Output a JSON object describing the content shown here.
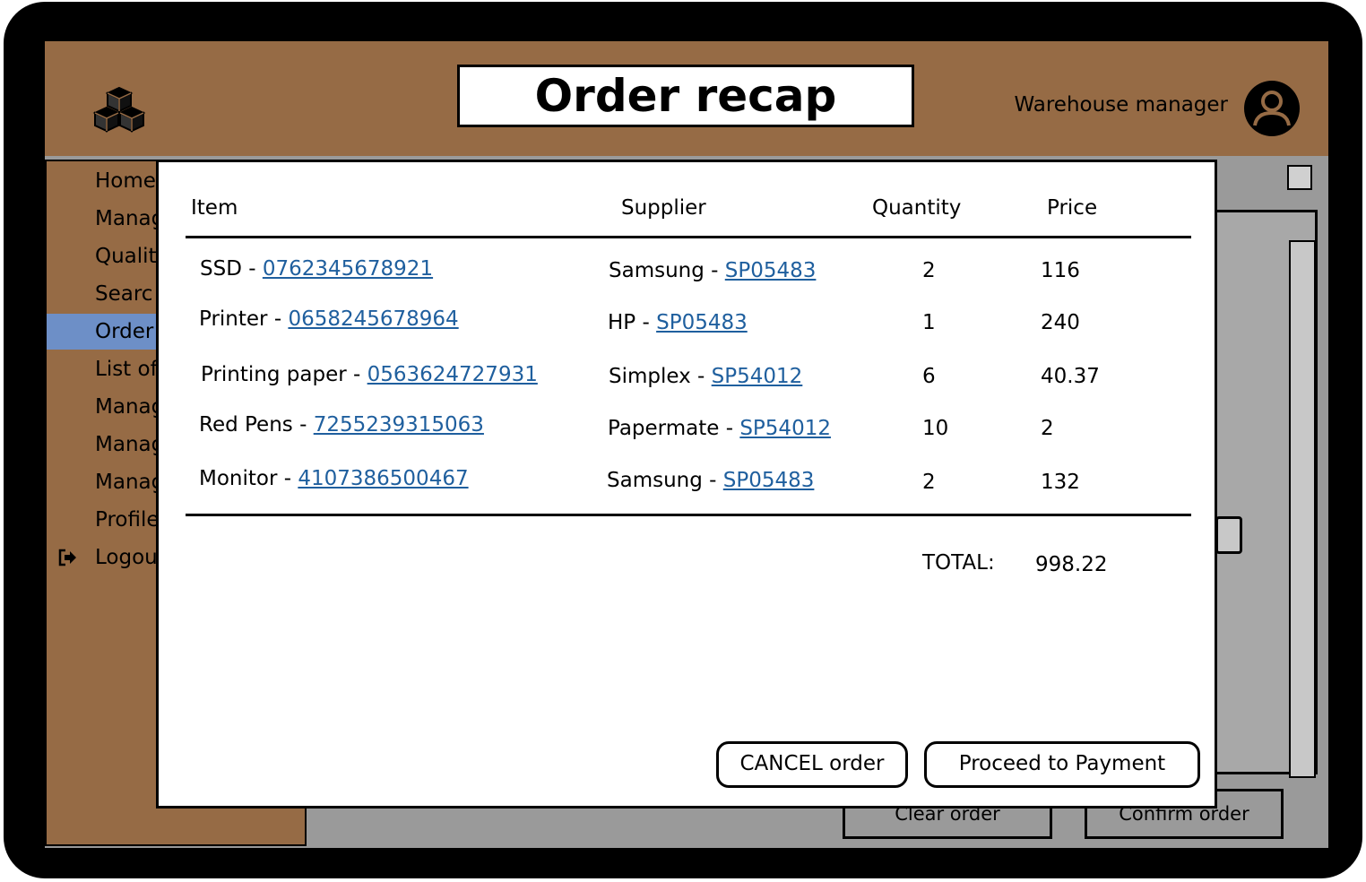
{
  "header": {
    "title": "Order recap",
    "user_label": "Warehouse manager"
  },
  "sidebar": {
    "items": [
      {
        "label": "Home"
      },
      {
        "label": "Manag"
      },
      {
        "label": "Qualit"
      },
      {
        "label": "Searc"
      },
      {
        "label": "Order",
        "active": true
      },
      {
        "label": "List of"
      },
      {
        "label": "Manag"
      },
      {
        "label": "Manag"
      },
      {
        "label": "Manag"
      },
      {
        "label": "Profile"
      },
      {
        "label": "Logou",
        "icon": "logout-icon"
      }
    ]
  },
  "background": {
    "clear_order_label": "Clear order",
    "confirm_order_label": "Confirm order"
  },
  "modal": {
    "columns": [
      "Item",
      "Supplier",
      "Quantity",
      "Price"
    ],
    "rows": [
      {
        "item": "SSD",
        "item_code": "0762345678921",
        "supplier": "Samsung",
        "supplier_code": "SP05483",
        "quantity": "2",
        "price": "116"
      },
      {
        "item": "Printer",
        "item_code": "0658245678964",
        "supplier": "HP",
        "supplier_code": "SP05483",
        "quantity": "1",
        "price": "240"
      },
      {
        "item": "Printing paper",
        "item_code": "0563624727931",
        "supplier": "Simplex",
        "supplier_code": "SP54012",
        "quantity": "6",
        "price": "40.37"
      },
      {
        "item": "Red Pens",
        "item_code": "7255239315063",
        "supplier": "Papermate",
        "supplier_code": "SP54012",
        "quantity": "10",
        "price": "2"
      },
      {
        "item": "Monitor",
        "item_code": "4107386500467",
        "supplier": "Samsung",
        "supplier_code": "SP05483",
        "quantity": "2",
        "price": "132"
      }
    ],
    "total_label": "TOTAL:",
    "total_value": "998.22",
    "cancel_label": "CANCEL order",
    "proceed_label": "Proceed to Payment"
  },
  "colors": {
    "header_bg": "#966b45",
    "sidebar_active": "#6d8fc7",
    "link": "#1f5f9e",
    "overlay_gray": "#9a9a9a"
  }
}
